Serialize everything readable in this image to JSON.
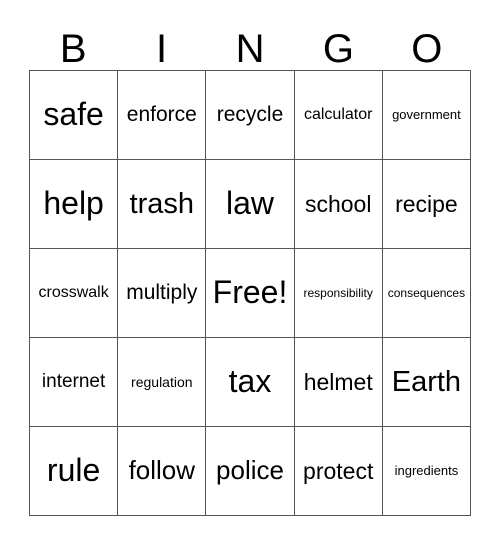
{
  "card": {
    "headers": [
      "B",
      "I",
      "N",
      "G",
      "O"
    ],
    "rows": [
      [
        {
          "text": "safe",
          "size": "fs-32"
        },
        {
          "text": "enforce",
          "size": "fs-21"
        },
        {
          "text": "recycle",
          "size": "fs-21"
        },
        {
          "text": "calculator",
          "size": "fs-16"
        },
        {
          "text": "government",
          "size": "fs-13"
        }
      ],
      [
        {
          "text": "help",
          "size": "fs-32"
        },
        {
          "text": "trash",
          "size": "fs-29"
        },
        {
          "text": "law",
          "size": "fs-32"
        },
        {
          "text": "school",
          "size": "fs-23"
        },
        {
          "text": "recipe",
          "size": "fs-23"
        }
      ],
      [
        {
          "text": "crosswalk",
          "size": "fs-16"
        },
        {
          "text": "multiply",
          "size": "fs-21"
        },
        {
          "text": "Free!",
          "size": "fs-32"
        },
        {
          "text": "responsibility",
          "size": "fs-12"
        },
        {
          "text": "consequences",
          "size": "fs-12"
        }
      ],
      [
        {
          "text": "internet",
          "size": "fs-19"
        },
        {
          "text": "regulation",
          "size": "fs-14"
        },
        {
          "text": "tax",
          "size": "fs-32"
        },
        {
          "text": "helmet",
          "size": "fs-23"
        },
        {
          "text": "Earth",
          "size": "fs-29"
        }
      ],
      [
        {
          "text": "rule",
          "size": "fs-32"
        },
        {
          "text": "follow",
          "size": "fs-26"
        },
        {
          "text": "police",
          "size": "fs-26"
        },
        {
          "text": "protect",
          "size": "fs-23"
        },
        {
          "text": "ingredients",
          "size": "fs-13"
        }
      ]
    ],
    "free_space": "Free!",
    "grid_size": "5x5",
    "border_color": "#555555",
    "text_color": "#000000",
    "background_color": "#ffffff"
  }
}
